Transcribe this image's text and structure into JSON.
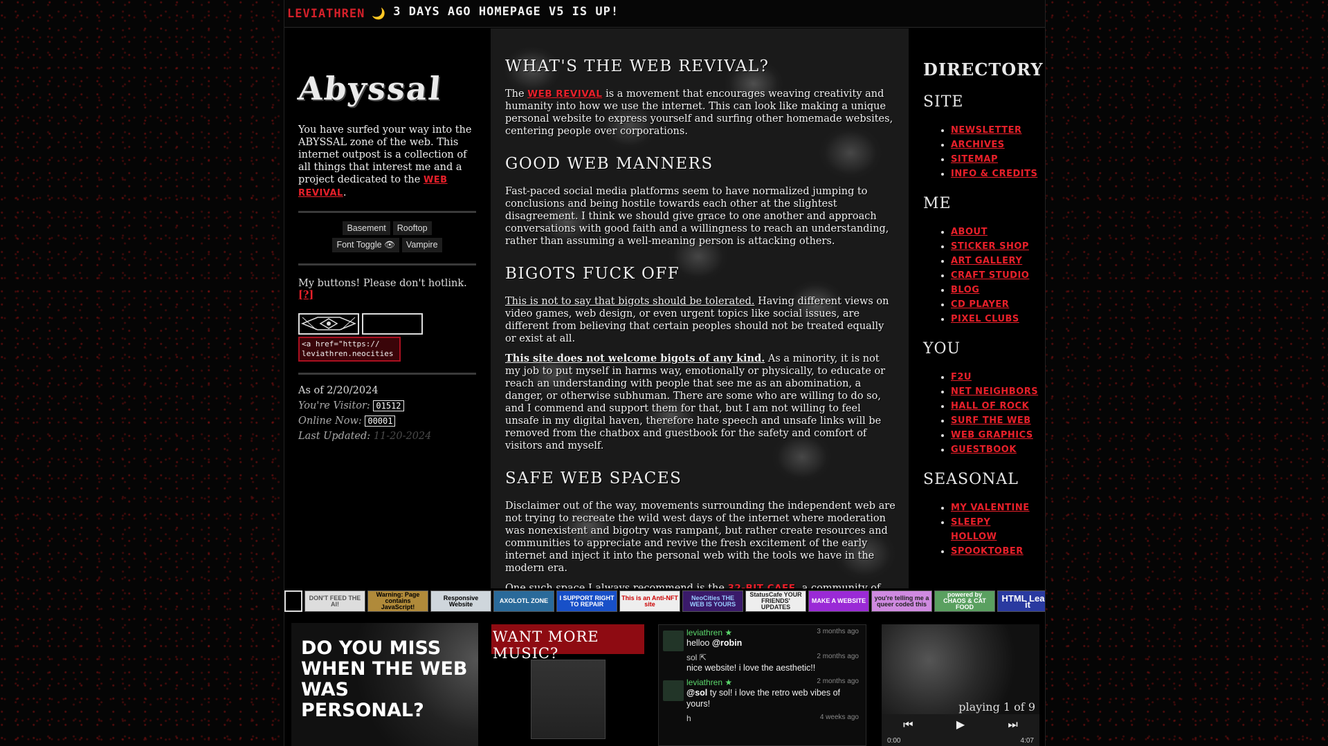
{
  "marquee": {
    "user": "LEVIATHREN",
    "emoji": "🌙",
    "message": "3 DAYS AGO HOMEPAGE V5 IS UP!"
  },
  "left": {
    "logo": "Abyssal",
    "intro_text": "You have surfed your way into the ABYSSAL zone of the web. This internet outpost is a collection of all things that interest me and a project dedicated to the",
    "intro_link": "WEB REVIVAL",
    "nav_buttons": [
      "Basement",
      "Rooftop",
      "Font Toggle 👁",
      "Vampire"
    ],
    "buttons_text": "My buttons! Please don't hotlink.",
    "buttons_help": "[?]",
    "code_snippet": "<a href=\"https://\nleviathren.neocities",
    "stats": {
      "as_of": "As of 2/20/2024",
      "visitor_label": "You're Visitor:",
      "visitor_count": "01512",
      "online_label": "Online Now:",
      "online_count": "00001",
      "updated_label": "Last Updated:",
      "updated_value": "11-20-2024"
    }
  },
  "main": {
    "s1_title": "What's the Web Revival?",
    "s1_pre": "The",
    "s1_link": "WEB REVIVAL",
    "s1_post": "is a movement that encourages weaving creativity and humanity into how we use the internet. This can look like making a unique personal website to express yourself and surfing other homemade websites, centering people over corporations.",
    "s2_title": "Good Web Manners",
    "s2_text": "Fast-paced social media platforms seem to have normalized jumping to conclusions and being hostile towards each other at the slightest disagreement. I think we should give grace to one another and approach conversations with good faith and a willingness to reach an understanding, rather than assuming a well-meaning person is attacking others.",
    "s3_title": "Bigots Fuck Off",
    "s3_p1_u": "This is not to say that bigots should be tolerated.",
    "s3_p1_rest": "Having different views on video games, web design, or even urgent topics like social issues, are different from believing that certain peoples should not be treated equally or exist at all.",
    "s3_p2_ub": "This site does not welcome bigots of any kind.",
    "s3_p2_rest": "As a minority, it is not my job to put myself in harms way, emotionally or physically, to educate or reach an understanding with people that see me as an abomination, a danger, or otherwise subhuman. There are some who are willing to do so, and I commend and support them for that, but I am not willing to feel unsafe in my digital haven, therefore hate speech and unsafe links will be removed from the chatbox and guestbook for the safety and comfort of visitors and myself.",
    "s4_title": "Safe Web Spaces",
    "s4_p1": "Disclaimer out of the way, movements surrounding the independent web are not trying to recreate the wild west days of the internet where moderation was nonexistent and bigotry was rampant, but rather create resources and communities to appreciate and revive the fresh excitement of the early internet and inject it into the personal web with the tools we have in the modern era.",
    "s4_p2_pre": "One such space I always recommend is the",
    "s4_p2_link": "32-BIT CAFE",
    "s4_p2_post": ", a community of web enthusiasts working together to build a fun, friendly place on the internet dedicated to"
  },
  "directory": {
    "title": "Directory",
    "sections": [
      {
        "title": "Site",
        "links": [
          "Newsletter",
          "Archives",
          "Sitemap",
          "Info & Credits"
        ]
      },
      {
        "title": "Me",
        "links": [
          "About",
          "Sticker Shop",
          "Art Gallery",
          "Craft Studio",
          "Blog",
          "CD Player",
          "Pixel Clubs"
        ]
      },
      {
        "title": "You",
        "links": [
          "F2U",
          "Net Neighbors",
          "Hall of Rock",
          "Surf the Web",
          "Web Graphics",
          "Guestbook"
        ]
      },
      {
        "title": "Seasonal",
        "links": [
          "My Valentine",
          "Sleepy Hollow",
          "Spooktober"
        ]
      }
    ]
  },
  "badges": [
    "",
    "DON'T FEED THE AI!",
    "Warning: Page contains JavaScript!",
    "Responsive Website",
    "AXOLOTL ZONE",
    "I SUPPORT RIGHT TO REPAIR",
    "This is an Anti-NFT site",
    "NeoCities THE WEB IS YOURS",
    "StatusCafe YOUR FRIENDS' UPDATES",
    "MAKE A WEBSITE",
    "you're telling me a queer coded this",
    "powered by CHAOS & CAT FOOD",
    "HTML Learn it"
  ],
  "badge_colors": [
    "#000",
    "#ddd",
    "#b08a3a",
    "#cfd6dc",
    "#2a6a9a",
    "#1850c8",
    "#eee",
    "#3a1a6a",
    "#eee",
    "#9a2ad6",
    "#cf8ae0",
    "#5aa060",
    "#2a3aa0"
  ],
  "bottom": {
    "persona_text": "Do you miss when the web was personal?",
    "music_title": "Want more music?",
    "chat": [
      {
        "name": "leviathren ★",
        "time": "3 months ago",
        "text": "helloo",
        "mention": "@robin",
        "avatar": true,
        "green": true
      },
      {
        "name": "sol",
        "time": "2 months ago",
        "text": "nice website! i love the aesthetic!!",
        "mention": "",
        "avatar": false,
        "green": false
      },
      {
        "name": "leviathren ★",
        "time": "2 months ago",
        "text": "ty sol! i love the retro web vibes of yours!",
        "mention": "@sol",
        "avatar": true,
        "green": true
      },
      {
        "name": "h",
        "time": "4 weeks ago",
        "text": "",
        "mention": "",
        "avatar": false,
        "green": false
      }
    ],
    "player": {
      "status": "playing 1 of 9",
      "time_current": "0:00",
      "time_total": "4:07"
    }
  }
}
